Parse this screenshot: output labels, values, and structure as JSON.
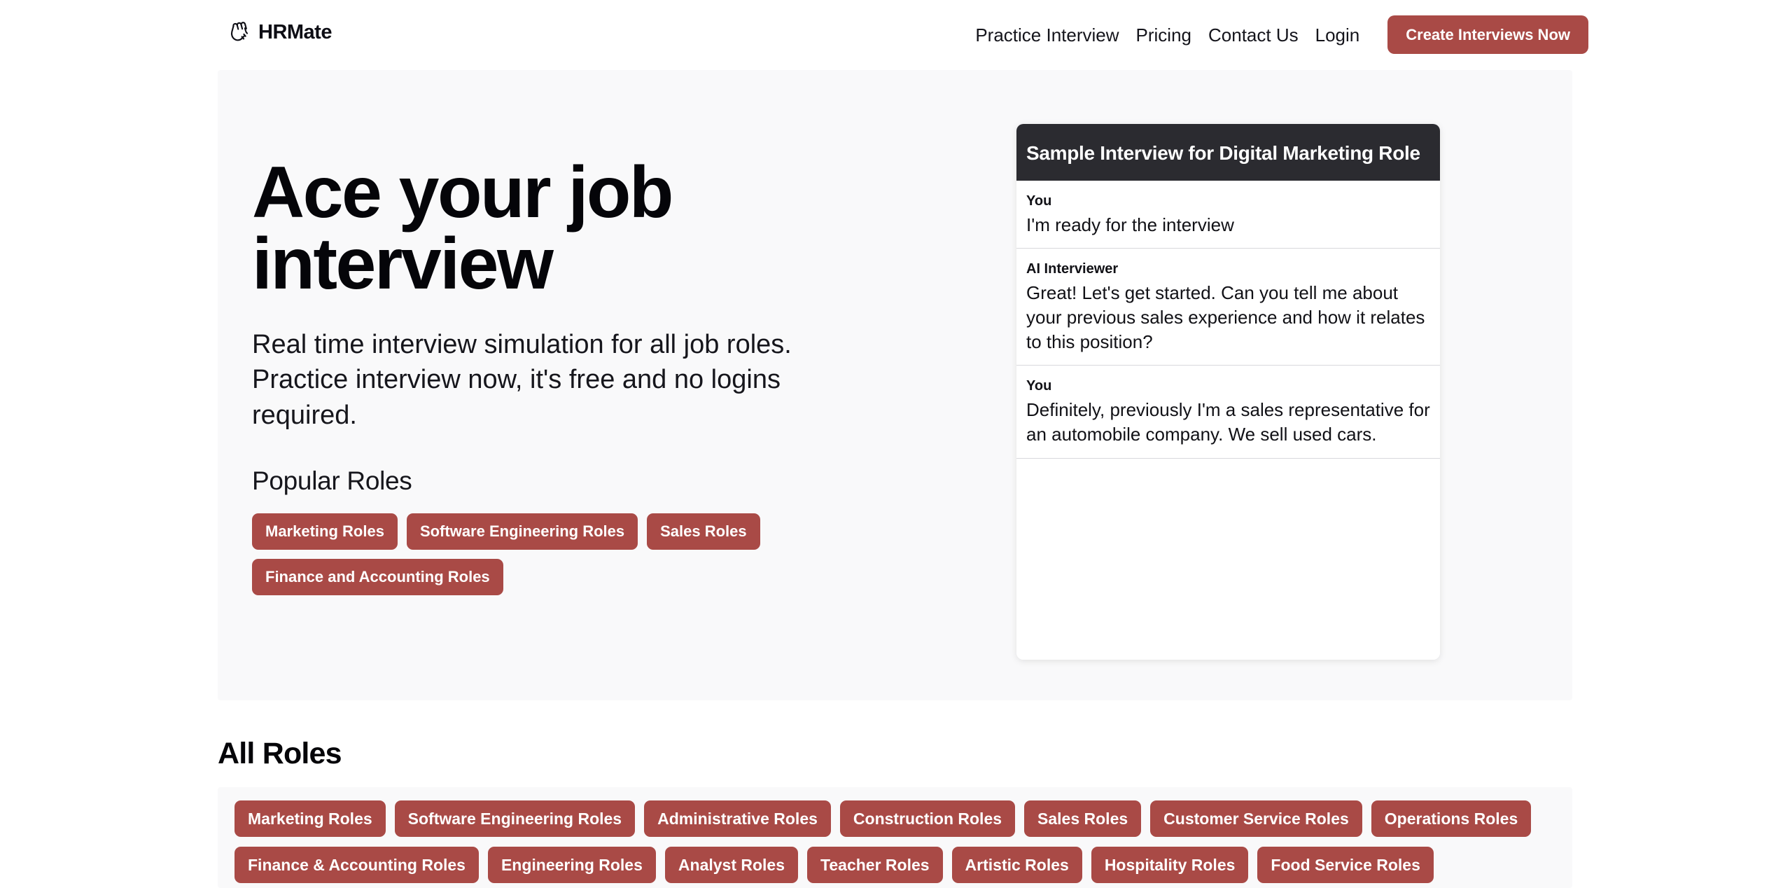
{
  "brand": {
    "name": "HRMate",
    "icon": "waving-hand-icon"
  },
  "nav": {
    "links": [
      {
        "label": "Practice Interview"
      },
      {
        "label": "Pricing"
      },
      {
        "label": "Contact Us"
      },
      {
        "label": "Login"
      }
    ],
    "cta_label": "Create Interviews Now"
  },
  "hero": {
    "title": "Ace your job interview",
    "subtitle": "Real time interview simulation for all job roles. Practice interview now, it's free and no logins required.",
    "popular_heading": "Popular Roles",
    "popular_roles": [
      {
        "label": "Marketing Roles"
      },
      {
        "label": "Software Engineering Roles"
      },
      {
        "label": "Sales Roles"
      },
      {
        "label": "Finance and Accounting Roles"
      }
    ]
  },
  "interview_card": {
    "header": "Sample Interview for Digital Marketing Role",
    "messages": [
      {
        "speaker": "You",
        "text": "I'm ready for the interview"
      },
      {
        "speaker": "AI Interviewer",
        "text": "Great! Let's get started. Can you tell me about your previous sales experience and how it relates to this position?"
      },
      {
        "speaker": "You",
        "text": "Definitely, previously I'm a sales representative for an automobile company. We sell used cars."
      }
    ]
  },
  "all_roles": {
    "heading": "All Roles",
    "roles": [
      {
        "label": "Marketing Roles"
      },
      {
        "label": "Software Engineering Roles"
      },
      {
        "label": "Administrative Roles"
      },
      {
        "label": "Construction Roles"
      },
      {
        "label": "Sales Roles"
      },
      {
        "label": "Customer Service Roles"
      },
      {
        "label": "Operations Roles"
      },
      {
        "label": "Finance & Accounting Roles"
      },
      {
        "label": "Engineering Roles"
      },
      {
        "label": "Analyst Roles"
      },
      {
        "label": "Teacher Roles"
      },
      {
        "label": "Artistic Roles"
      },
      {
        "label": "Hospitality Roles"
      },
      {
        "label": "Food Service Roles"
      }
    ]
  },
  "colors": {
    "accent_red": "#a94a46",
    "panel_bg": "#f9f9fa",
    "card_header_bg": "#2b2b30",
    "text_dark": "#050509"
  }
}
